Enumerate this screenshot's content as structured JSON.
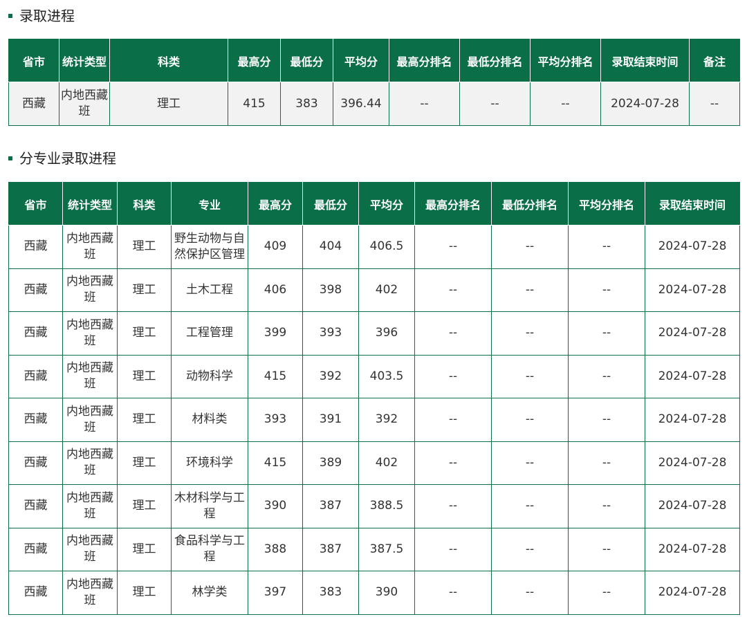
{
  "section1": {
    "title": "录取进程",
    "headers": [
      "省市",
      "统计类型",
      "科类",
      "最高分",
      "最低分",
      "平均分",
      "最高分排名",
      "最低分排名",
      "平均分排名",
      "录取结束时间",
      "备注"
    ],
    "row": [
      "西藏",
      "内地西藏班",
      "理工",
      "415",
      "383",
      "396.44",
      "--",
      "--",
      "--",
      "2024-07-28",
      "--"
    ]
  },
  "section2": {
    "title": "分专业录取进程",
    "headers": [
      "省市",
      "统计类型",
      "科类",
      "专业",
      "最高分",
      "最低分",
      "平均分",
      "最高分排名",
      "最低分排名",
      "平均分排名",
      "录取结束时间"
    ],
    "rows": [
      [
        "西藏",
        "内地西藏班",
        "理工",
        "野生动物与自然保护区管理",
        "409",
        "404",
        "406.5",
        "--",
        "--",
        "--",
        "2024-07-28"
      ],
      [
        "西藏",
        "内地西藏班",
        "理工",
        "土木工程",
        "406",
        "398",
        "402",
        "--",
        "--",
        "--",
        "2024-07-28"
      ],
      [
        "西藏",
        "内地西藏班",
        "理工",
        "工程管理",
        "399",
        "393",
        "396",
        "--",
        "--",
        "--",
        "2024-07-28"
      ],
      [
        "西藏",
        "内地西藏班",
        "理工",
        "动物科学",
        "415",
        "392",
        "403.5",
        "--",
        "--",
        "--",
        "2024-07-28"
      ],
      [
        "西藏",
        "内地西藏班",
        "理工",
        "材料类",
        "393",
        "391",
        "392",
        "--",
        "--",
        "--",
        "2024-07-28"
      ],
      [
        "西藏",
        "内地西藏班",
        "理工",
        "环境科学",
        "415",
        "389",
        "402",
        "--",
        "--",
        "--",
        "2024-07-28"
      ],
      [
        "西藏",
        "内地西藏班",
        "理工",
        "木材科学与工程",
        "390",
        "387",
        "388.5",
        "--",
        "--",
        "--",
        "2024-07-28"
      ],
      [
        "西藏",
        "内地西藏班",
        "理工",
        "食品科学与工程",
        "388",
        "387",
        "387.5",
        "--",
        "--",
        "--",
        "2024-07-28"
      ],
      [
        "西藏",
        "内地西藏班",
        "理工",
        "林学类",
        "397",
        "383",
        "390",
        "--",
        "--",
        "--",
        "2024-07-28"
      ]
    ]
  },
  "colors": {
    "header_bg": "#0a6e47",
    "header_text": "#ffffff",
    "border": "#0a6e47",
    "row_bg_summary": "#f2f2f2"
  }
}
